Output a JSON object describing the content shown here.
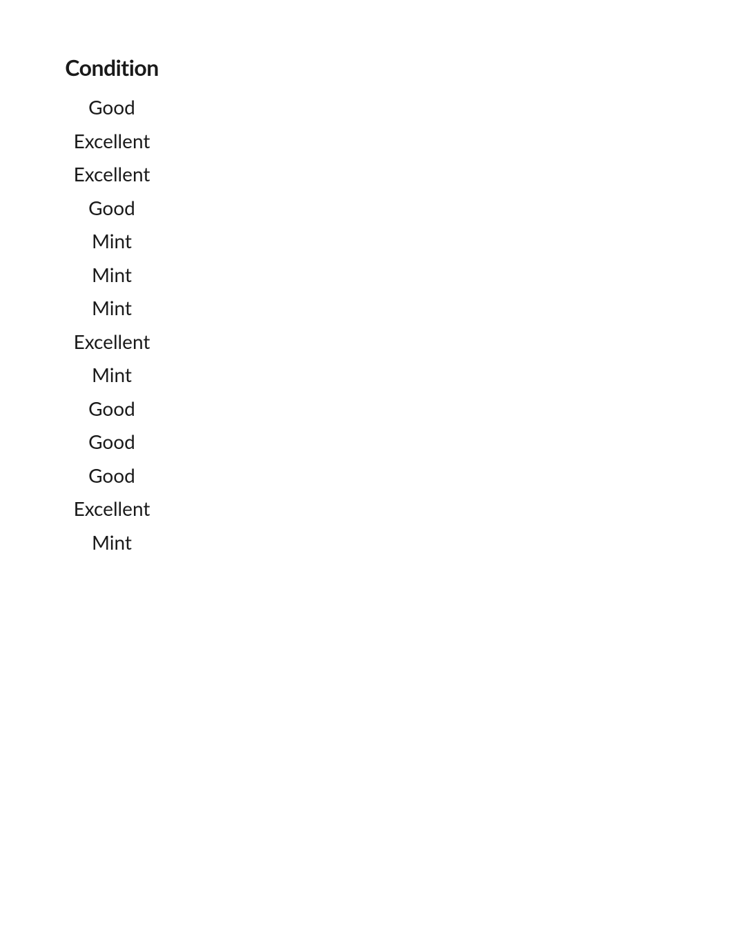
{
  "table": {
    "header": "Condition",
    "rows": [
      "Good",
      "Excellent",
      "Excellent",
      "Good",
      "Mint",
      "Mint",
      "Mint",
      "Excellent",
      "Mint",
      "Good",
      "Good",
      "Good",
      "Excellent",
      "Mint"
    ]
  }
}
